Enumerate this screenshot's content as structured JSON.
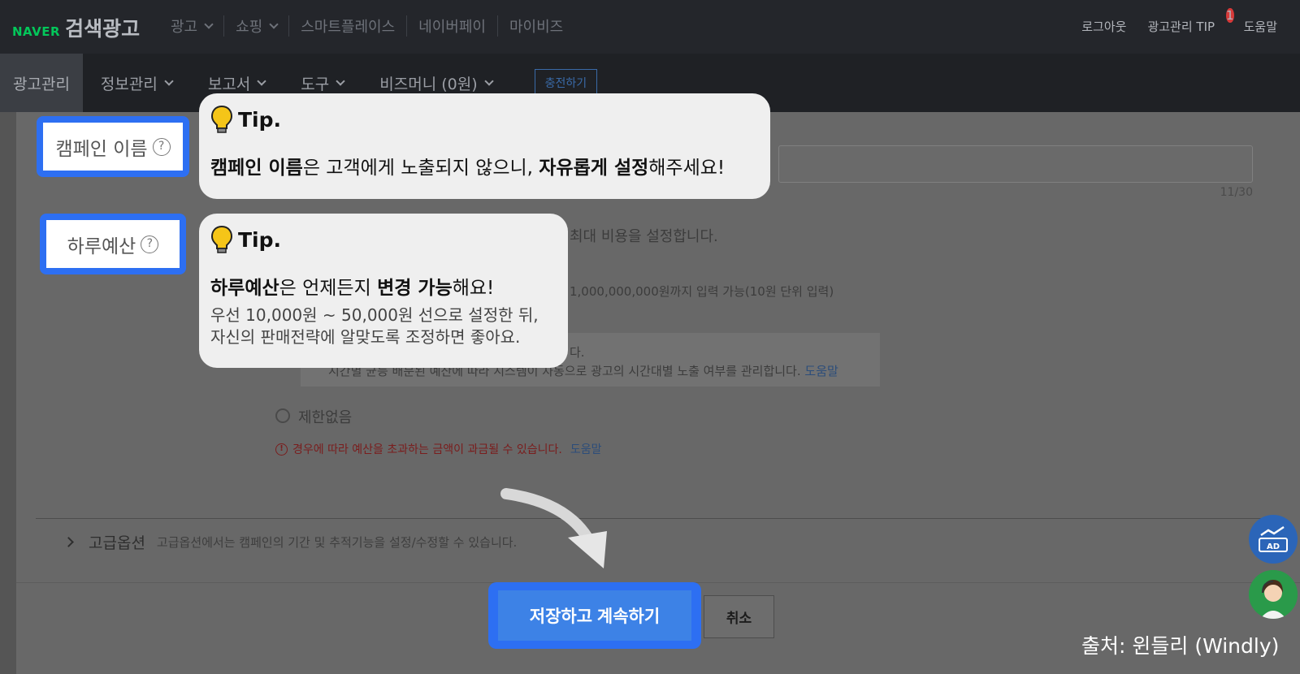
{
  "header": {
    "brand": "NAVER",
    "product": "검색광고",
    "nav": [
      {
        "label": "광고",
        "dropdown": true
      },
      {
        "label": "쇼핑",
        "dropdown": true
      },
      {
        "label": "스마트플레이스",
        "dropdown": false
      },
      {
        "label": "네이버페이",
        "dropdown": false
      },
      {
        "label": "마이비즈",
        "dropdown": false
      }
    ],
    "links": {
      "logout": "로그아웃",
      "tip": "광고관리 TIP",
      "tip_badge": "1",
      "help": "도움말"
    }
  },
  "subnav": {
    "items": [
      {
        "label": "광고관리"
      },
      {
        "label": "정보관리"
      },
      {
        "label": "보고서"
      },
      {
        "label": "도구"
      },
      {
        "label": "비즈머니 (0원)"
      }
    ],
    "charge_label": "충전하기"
  },
  "form": {
    "campaign_name_label": "캠페인 이름",
    "name_counter": "11/30",
    "daily_budget_label": "하루예산",
    "budget_desc": "최대 비용을 설정합니다.",
    "budget_range": "1,000,000,000원까지 입력 가능(10원 단위 입력)",
    "box_line1_end": "다.",
    "box_line2": "시간별 균등 배분된 예산에 따라 시스템이 자동으로 광고의 시간대별 노출 여부를 관리합니다.",
    "box_help": "도움말",
    "no_limit": "제한없음",
    "warning": "경우에 따라 예산을 초과하는 금액이 과금될 수 있습니다.",
    "warning_help": "도움말",
    "advanced_label": "고급옵션",
    "advanced_desc": "고급옵션에서는 캠페인의 기간 및 추적기능을 설정/수정할 수 있습니다.",
    "save_label": "저장하고 계속하기",
    "cancel_label": "취소"
  },
  "tips": {
    "tip1": {
      "head": "Tip.",
      "b1": "캠페인 이름",
      "t1": "은 고객에게 노출되지 않으니, ",
      "b2": "자유롭게 설정",
      "t2": "해주세요!"
    },
    "tip2": {
      "head": "Tip.",
      "b1": "하루예산",
      "t1": "은 언제든지 ",
      "b2": "변경 가능",
      "t2": "해요!",
      "sub1": "우선 10,000원 ~ 50,000원 선으로 설정한 뒤,",
      "sub2": "자신의 판매전략에 알맞도록 조정하면 좋아요."
    }
  },
  "floating": {
    "ad_label": "AD"
  },
  "source": "출처: 윈들리 (Windly)",
  "colors": {
    "highlight": "#2d6ff2",
    "primary_button": "#3d82e6",
    "brand_green": "#03c75a"
  }
}
